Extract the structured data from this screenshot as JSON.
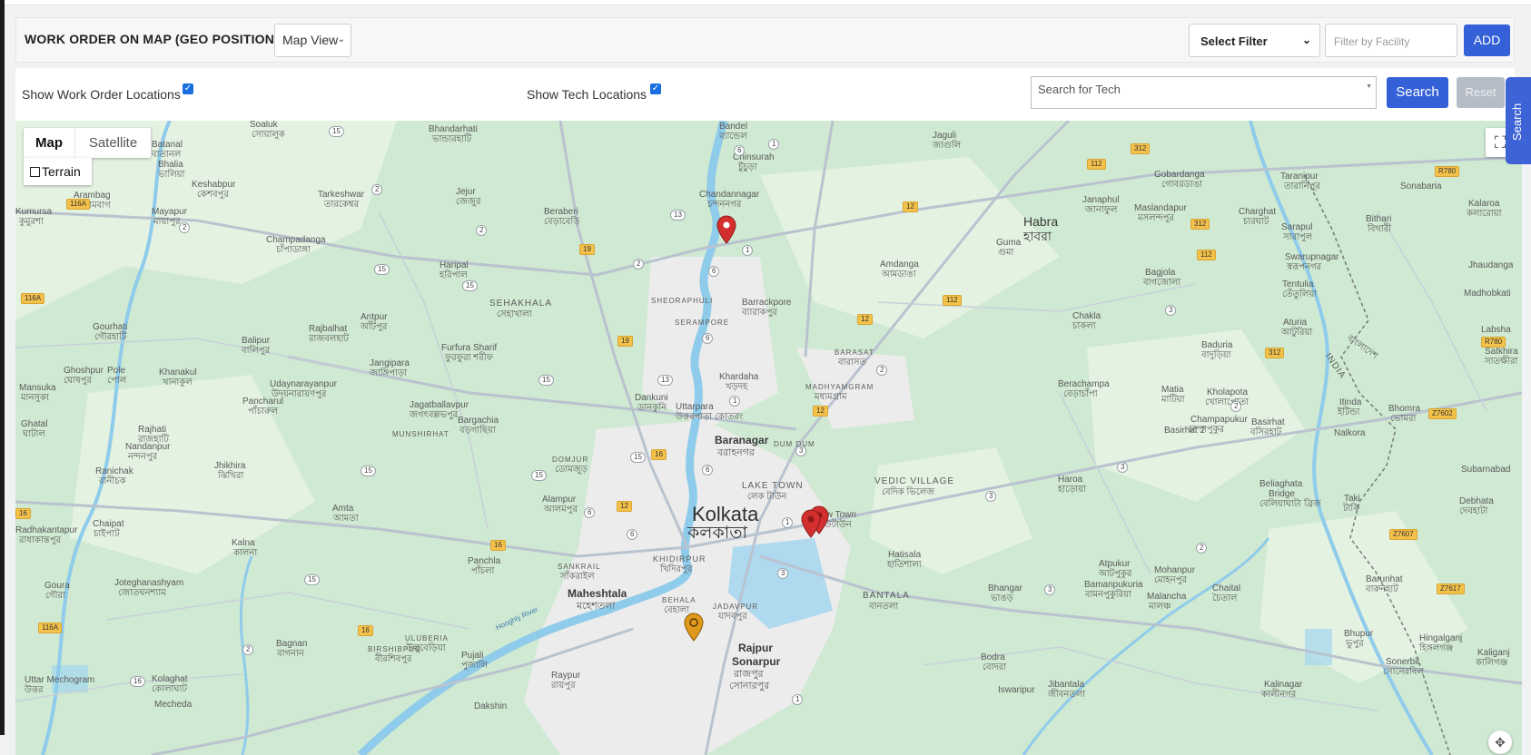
{
  "header": {
    "title": "WORK ORDER ON MAP (GEO POSITION)",
    "view_select": "Map View",
    "filter_select": "Select Filter",
    "facility_placeholder": "Filter by Facility",
    "add_label": "ADD"
  },
  "options": {
    "show_work_orders_label": "Show Work Order Locations",
    "show_work_orders_checked": true,
    "show_tech_label": "Show Tech Locations",
    "show_tech_checked": true,
    "tech_search_placeholder": "Search for Tech",
    "search_label": "Search",
    "reset_label": "Reset"
  },
  "side_tab": {
    "label": "Search"
  },
  "map": {
    "type_tabs": [
      "Map",
      "Satellite"
    ],
    "active_type": "Map",
    "terrain_label": "Terrain",
    "terrain_checked": false,
    "places": {
      "kolkata": "Kolkata",
      "kolkata_bn": "কলকাতা",
      "habra": "Habra",
      "habra_bn": "হাবরা",
      "baranagar": "Baranagar",
      "baranagar_bn": "বরাহনগর",
      "maheshtala": "Maheshtala",
      "maheshtala_bn": "মহেশতলা",
      "rajpur": "Rajpur",
      "sonarpur": "Sonarpur",
      "rajpur_bn": "রাজপুর",
      "sonarpur_bn": "সোনারপুর",
      "lake_town": "LAKE TOWN",
      "lake_town_bn": "লেক টাউন",
      "new_town": "New Town",
      "new_town_bn": "নিউটাউন",
      "bantala": "BANTALA",
      "bantala_bn": "বানতলা",
      "vedic_village": "VEDIC VILLAGE",
      "vedic_village_bn": "বেদিক ভিলেজ",
      "dum_dum": "DUM DUM",
      "khidirpur": "KHIDIRPUR",
      "khidirpur_bn": "খিদিরপুর",
      "behala": "BEHALA",
      "behala_bn": "বেহালা",
      "jadavpur": "JADAVPUR",
      "jadavpur_bn": "যাদবপুর",
      "barasat": "BARASAT",
      "barasat_bn": "বারাসত",
      "madhyamgram": "MADHYAMGRAM",
      "madhyamgram_bn": "মধ্যমগ্রাম",
      "sehakhala": "SEHAKHALA",
      "sehakhala_bn": "সেহাখালা",
      "sheoraphuli": "SHEORAPHULI",
      "serampore": "SERAMPORE",
      "barrackpore": "Barrackpore",
      "barrackpore_bn": "ব্যারাকপুর",
      "khardaha": "Khardaha",
      "khardaha_bn": "খড়দহ",
      "uttarpara": "Uttarpara",
      "uttarpara_bn": "উত্তরপাড়া কোতরং",
      "dankuni": "Dankuni",
      "dankuni_bn": "ডানকুনি",
      "chandannagar": "Chandannagar",
      "chandannagar_bn": "চন্দননগর",
      "chinsurah": "Chinsurah",
      "chinsurah_bn": "চুঁচুড়া",
      "bandel": "Bandel",
      "bandel_bn": "ব্যান্ডেল",
      "jaguli": "Jaguli",
      "jaguli_bn": "জাগুলি",
      "amdanga": "Amdanga",
      "amdanga_bn": "আমডাঙা",
      "guma": "Guma",
      "guma_bn": "গুমা",
      "janaphul": "Janaphul",
      "janaphul_bn": "জানাফুল",
      "maslandapur": "Maslandapur",
      "maslandapur_bn": "মসলন্দপুর",
      "gobardanga": "Gobardanga",
      "gobardanga_bn": "গোবরডাঙা",
      "charghat": "Charghat",
      "charghat_bn": "চারঘাট",
      "taranipur": "Taranipur",
      "taranipur_bn": "তারানিপুর",
      "sarapul": "Sarapul",
      "sarapul_bn": "সারাপুল",
      "swarupnagar": "Swarupnagar",
      "swarupnagar_bn": "স্বরূপনগর",
      "tentulia": "Tentulia",
      "tentulia_bn": "তেঁতুলিয়া",
      "bagjola": "Bagjola",
      "bagjola_bn": "বাগজোলা",
      "chakla": "Chakla",
      "chakla_bn": "চাকলা",
      "atulia": "Aturia",
      "atulia_bn": "আটুরিয়া",
      "baduria": "Baduria",
      "baduria_bn": "বাদুড়িয়া",
      "berachampa": "Berachampa",
      "berachampa_bn": "বেড়াচাঁপা",
      "matia": "Matia",
      "matia_bn": "মাটিয়া",
      "kholapota": "Kholapota",
      "kholapota_bn": "খোলাপোতা",
      "champapukur": "Champapukur",
      "champapukur_bn": "চম্পাপুকুর",
      "basirhat": "Basirhat",
      "basirhat_bn": "বসিরহাট",
      "basirhat2": "Basirhat 2",
      "itinda": "Itinda",
      "itinda_bn": "ইটিন্ডা",
      "bhomra": "Bhomra",
      "bhomra_bn": "ভোমরা",
      "nalkora": "Nalkora",
      "bithari": "Bithari",
      "bithari_bn": "বিথারী",
      "sonabaria": "Sonabaria",
      "kalaroa": "Kalaroa",
      "kalaroa_bn": "কলারোয়া",
      "jhaudanga": "Jhaudanga",
      "madhobkati": "Madhobkati",
      "labsha": "Labsha",
      "satkhira": "Satkhira",
      "satkhira_bn": "সাতক্ষীরা",
      "subarnabad": "Subarnabad",
      "debhata": "Debhata",
      "debhata_bn": "দেবহাটা",
      "taki": "Taki",
      "taki_bn": "টাকি",
      "beliaghata": "Beliaghata",
      "bridge": "Bridge",
      "beliaghata_bn": "বেলিয়াঘাটা ব্রিজ",
      "haroa": "Haroa",
      "haroa_bn": "হাড়োয়া",
      "hatisala": "Hatisala",
      "hatisala_bn": "হাতিশালা",
      "bhangar": "Bhangar",
      "bhangar_bn": "ভাঙড়",
      "atpukur": "Atpukur",
      "atpukur_bn": "আটপুকুর",
      "bamanpukuria": "Bamanpukuria",
      "bamanpukuria_bn": "বামনপুকুরিয়া",
      "mohanpur": "Mohanpur",
      "mohanpur_bn": "মোহনপুর",
      "malancha": "Malancha",
      "malancha_bn": "মালঞ্চ",
      "chaital": "Chaital",
      "chaital_bn": "চৈতাল",
      "barunhat": "Barunhat",
      "barunhat_bn": "বারুনহাট",
      "bhupur": "Bhupur",
      "bhupur_bn": "ভুপুর",
      "hingalganj": "Hingalganj",
      "hingalganj_bn": "হিঙ্গলগঞ্জ",
      "sonerbil": "Sonerbil",
      "sonerbil_bn": "সোনেরবিল",
      "kaliganj": "Kaliganj",
      "kaliganj_bn": "কালিগঞ্জ",
      "bodra": "Bodra",
      "bodra_bn": "বোদরা",
      "iswaripur": "Iswaripur",
      "jibantala": "Jibantala",
      "jibantala_bn": "জীবনতলা",
      "kalinagar": "Kalinagar",
      "kalinagar_bn": "কালীনগর",
      "india": "INDIA",
      "bangladesh_bn": "বাংলাদেশ",
      "soaluk": "Soaluk",
      "soaluk_bn": "সোয়ালুক",
      "bhandarhati": "Bhandarhati",
      "bhandarhati_bn": "ভান্ডারহাটি",
      "batanal": "Batanal",
      "batanal_bn": "বাতানল",
      "bhalia": "Bhalia",
      "bhalia_bn": "ভালিয়া",
      "keshabpur": "Keshabpur",
      "keshabpur_bn": "কেশবপুর",
      "arambag": "Arambag",
      "arambag_bn": "আরামবাগ",
      "kumursa": "Kumursa",
      "kumursa_bn": "কুমুরশা",
      "mayapur": "Mayapur",
      "mayapur_bn": "মায়াপুর",
      "tarkeshwar": "Tarkeshwar",
      "tarkeshwar_bn": "তারকেশ্বর",
      "jejur": "Jejur",
      "jejur_bn": "জেজুর",
      "beraberi": "Beraberi",
      "beraberi_bn": "বেড়াবেড়ি",
      "champadanga": "Champadanga",
      "champadanga_bn": "চাঁপাডাঙ্গা",
      "haripal": "Haripal",
      "haripal_bn": "হরিপাল",
      "gourhati": "Gourhati",
      "gourhati_bn": "গৌরহাটি",
      "balipur": "Balipur",
      "balipur_bn": "বালিপুর",
      "rajbalhat": "Rajbalhat",
      "rajbalhat_bn": "রাজবলহাট",
      "antpur": "Antpur",
      "antpur_bn": "আঁটপুর",
      "furfura": "Furfura Sharif",
      "furfura_bn": "ফুরফুরা শরীফ",
      "ghoshpur": "Ghoshpur",
      "ghoshpur_bn": "ঘোষপুর",
      "pole": "Pole",
      "pole_bn": "পোল",
      "khanakul": "Khanakul",
      "khanakul_bn": "খানাকুল",
      "jangipara": "Jangipara",
      "jangipara_bn": "জাঙ্গিপাড়া",
      "udaynarayanpur": "Udaynarayanpur",
      "udaynarayanpur_bn": "উদয়নারায়ণপুর",
      "mansuka": "Mansuka",
      "mansuka_bn": "মানসুকা",
      "pancharul": "Pancharul",
      "pancharul_bn": "পাঁচারুল",
      "jagatballavpur": "Jagatballavpur",
      "jagatballavpur_bn": "জগৎবল্লভপুর",
      "rajhati": "Rajhati",
      "rajhati_bn": "রাজহাটি",
      "bargachia": "Bargachia",
      "bargachia_bn": "বড়গাছিয়া",
      "munshirhat": "MUNSHIRHAT",
      "ghatal": "Ghatal",
      "ghatal_bn": "ঘাটাল",
      "nandanpur": "Nandanpur",
      "nandanpur_bn": "নন্দনপুর",
      "jhikhira": "Jhikhira",
      "jhikhira_bn": "ঝিখিরা",
      "domjur": "DOMJUR",
      "domjur_bn": "ডোমজুড়",
      "ranichak": "Ranichak",
      "ranichak_bn": "রানীচক",
      "alampur": "Alampur",
      "alampur_bn": "আলমপুর",
      "amta": "Amta",
      "amta_bn": "আমতা",
      "radhakantapur": "Radhakantapur",
      "radhakantapur_bn": "রাধাকান্তপুর",
      "chaipat": "Chaipat",
      "chaipat_bn": "চাইপাট",
      "kalna": "Kalna",
      "kalna_bn": "কালনা",
      "panchla": "Panchla",
      "panchla_bn": "পাঁচলা",
      "sankrail": "SANKRAIL",
      "sankrail_bn": "সাঁকরাইল",
      "goura": "Goura",
      "goura_bn": "গৌরা",
      "joteghanashyam": "Joteghanashyam",
      "joteghanashyam_bn": "জোতঘনশ্যাম",
      "bagnan": "Bagnan",
      "bagnan_bn": "বাগনান",
      "uluberia": "ULUBERIA",
      "uluberia_bn": "উলুবেড়িয়া",
      "birshibpur": "BIRSHIBPUR",
      "birshibpur_bn": "বীরশিবপুর",
      "pujali": "Pujali",
      "pujali_bn": "পুজালি",
      "hooghly_river": "Hooghly River",
      "kolaghat": "Kolaghat",
      "kolaghat_bn": "কোলাঘাট",
      "uttar_mechogram": "Uttar Mechogram",
      "uttar_bn": "উত্তর",
      "mecheda": "Mecheda",
      "raypur": "Raypur",
      "raypur_bn": "রায়পুর",
      "dakshin": "Dakshin"
    }
  },
  "colors": {
    "primary": "#3461d8",
    "reset": "#b5bcc7",
    "land": "#cfe9d2",
    "urban": "#eaeaea",
    "water": "#a3d6f0",
    "marker_red": "#d32f2f",
    "marker_orange": "#e09a1b"
  }
}
